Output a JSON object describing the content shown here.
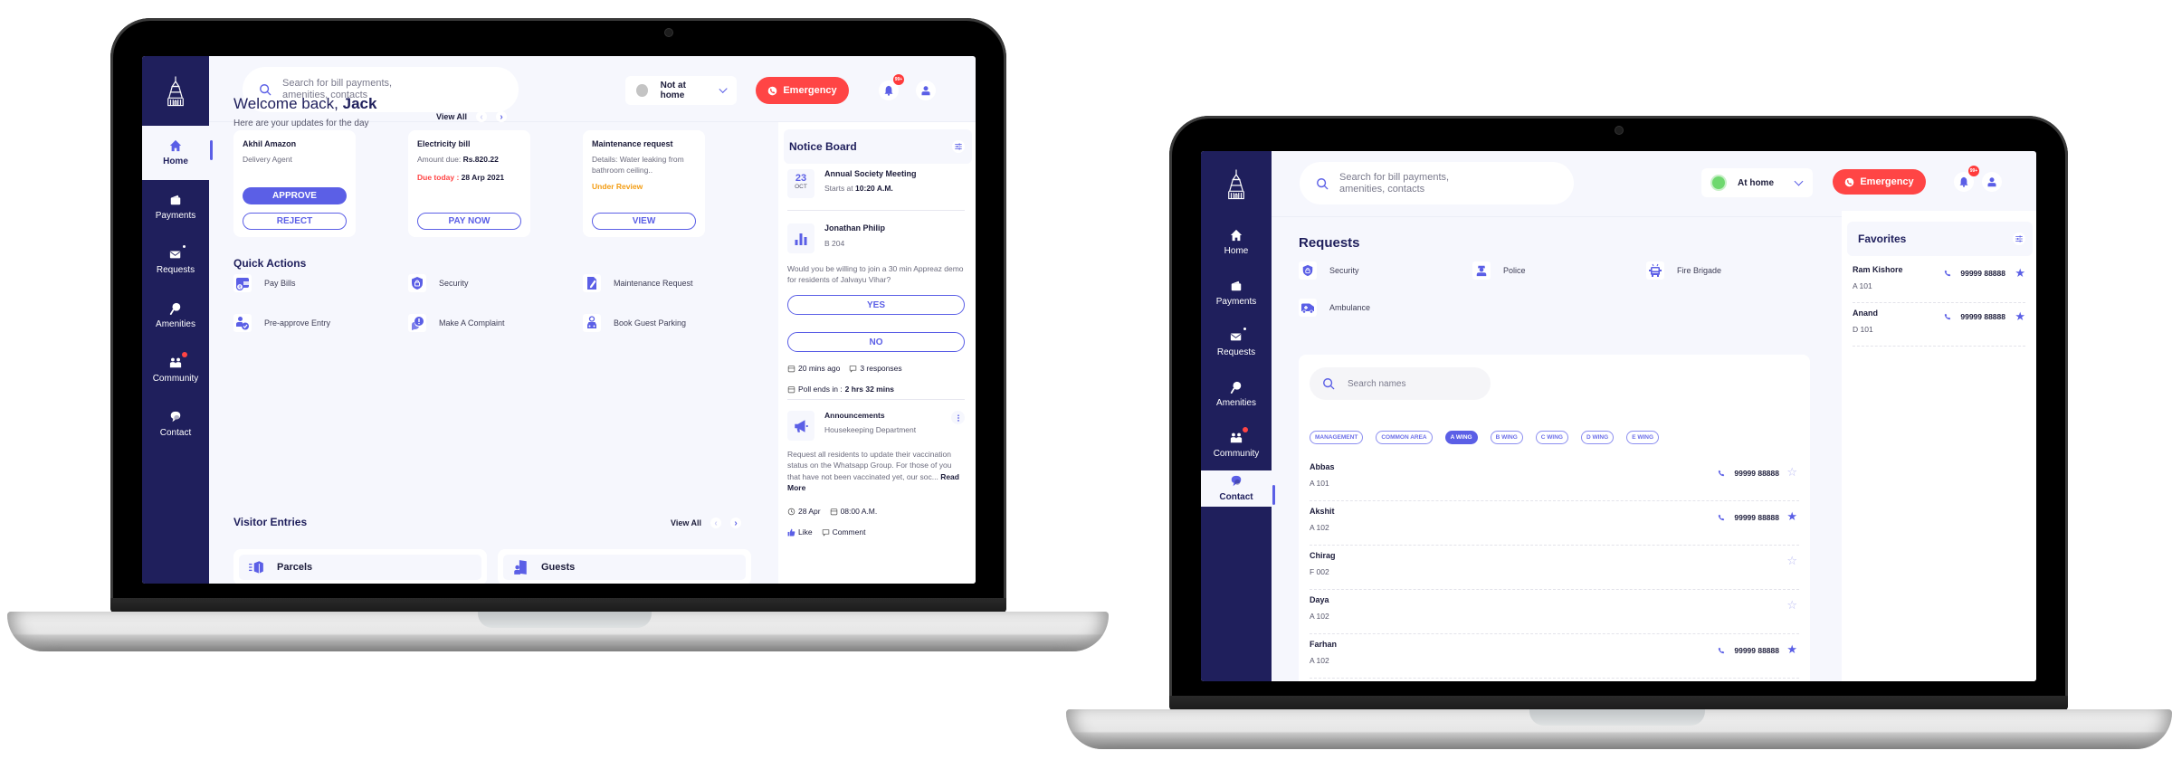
{
  "brand": {
    "primary": "#5b5fe6",
    "sidebar": "#1f1f5c",
    "danger": "#ff4545",
    "warning": "#f39c12",
    "background": "#f6f7fd"
  },
  "sidebar": {
    "logo_icon": "building-icon",
    "items": [
      {
        "label": "Home",
        "icon": "home-icon"
      },
      {
        "label": "Payments",
        "icon": "wallet-icon"
      },
      {
        "label": "Requests",
        "icon": "mail-icon"
      },
      {
        "label": "Amenities",
        "icon": "table-tennis-icon"
      },
      {
        "label": "Community",
        "icon": "people-icon"
      },
      {
        "label": "Contact",
        "icon": "chat-icon"
      }
    ]
  },
  "topbar": {
    "search_placeholder": "Search for bill payments, amenities, contacts",
    "emergency_label": "Emergency",
    "notification_badge": "99+"
  },
  "home_screen": {
    "status": {
      "label": "Not at home",
      "color": "#c4c4c4"
    },
    "welcome_prefix": "Welcome back,",
    "user_name": "Jack",
    "subtitle": "Here are your updates for the day",
    "view_all": "View All",
    "cards": [
      {
        "title": "Akhil Amazon",
        "line1": "Delivery Agent",
        "primary_button": "APPROVE",
        "secondary_button": "REJECT"
      },
      {
        "title": "Electricity bill",
        "amount_label": "Amount due:",
        "amount_value": "Rs.820.22",
        "due_label": "Due today",
        "due_date": "28 Arp 2021",
        "secondary_button": "PAY NOW"
      },
      {
        "title": "Maintenance request",
        "details": "Details: Water leaking from bathroom ceiling..",
        "status": "Under Review",
        "secondary_button": "VIEW"
      }
    ],
    "quick_actions_title": "Quick Actions",
    "quick_actions": [
      {
        "label": "Pay Bills",
        "icon": "wallet-rupee-icon"
      },
      {
        "label": "Security",
        "icon": "shield-lock-icon"
      },
      {
        "label": "Maintenance Request",
        "icon": "edit-document-icon"
      },
      {
        "label": "Pre-approve Entry",
        "icon": "user-check-icon"
      },
      {
        "label": "Make A Complaint",
        "icon": "complaint-icon"
      },
      {
        "label": "Book Guest Parking",
        "icon": "car-pin-icon"
      }
    ],
    "visitor_entries_title": "Visitor Entries",
    "visitor_entries": [
      {
        "label": "Parcels",
        "icon": "parcel-icon"
      },
      {
        "label": "Guests",
        "icon": "guest-door-icon"
      }
    ],
    "notice_board": {
      "title": "Notice Board",
      "meeting": {
        "day": "23",
        "month": "OCT",
        "title": "Annual Society Meeting",
        "starts_label": "Starts at",
        "time": "10:20 A.M."
      },
      "poll": {
        "author": "Jonathan Philip",
        "unit": "B 204",
        "question": "Would you be willing to join a 30 min Appreaz demo for residents of Jalvayu Vihar?",
        "options": [
          "YES",
          "NO"
        ],
        "posted": "20 mins ago",
        "responses": "3 responses",
        "ends_label": "Poll ends in :",
        "ends_value": "2 hrs 32 mins"
      },
      "announcement": {
        "title": "Announcements",
        "department": "Housekeeping Department",
        "body": "Request all residents to update their vaccination status on the Whatsapp Group. For those of you that have not been vaccinated yet, our soc...",
        "read_more": "Read More",
        "date": "28 Apr",
        "time": "08:00 A.M.",
        "like": "Like",
        "comment": "Comment"
      }
    }
  },
  "contact_screen": {
    "status": {
      "label": "At home",
      "color": "#6fd86f"
    },
    "requests_title": "Requests",
    "requests": [
      {
        "label": "Security",
        "icon": "shield-lock-icon"
      },
      {
        "label": "Police",
        "icon": "police-icon"
      },
      {
        "label": "Fire Brigade",
        "icon": "fire-truck-icon"
      },
      {
        "label": "Ambulance",
        "icon": "ambulance-icon"
      }
    ],
    "name_search_placeholder": "Search names",
    "filters": [
      {
        "label": "MANAGEMENT",
        "active": false
      },
      {
        "label": "COMMON AREA",
        "active": false
      },
      {
        "label": "A WING",
        "active": true
      },
      {
        "label": "B WING",
        "active": false
      },
      {
        "label": "C WING",
        "active": false
      },
      {
        "label": "D WING",
        "active": false
      },
      {
        "label": "E WING",
        "active": false
      }
    ],
    "contacts": [
      {
        "name": "Abbas",
        "unit": "A 101",
        "phone": "99999 88888",
        "favorite": false
      },
      {
        "name": "Akshit",
        "unit": "A 102",
        "phone": "99999 88888",
        "favorite": true
      },
      {
        "name": "Chirag",
        "unit": "F 002",
        "phone": "",
        "favorite": false
      },
      {
        "name": "Daya",
        "unit": "A 102",
        "phone": "",
        "favorite": false
      },
      {
        "name": "Farhan",
        "unit": "A 102",
        "phone": "99999 88888",
        "favorite": true
      }
    ],
    "favorites_title": "Favorites",
    "favorites": [
      {
        "name": "Ram Kishore",
        "unit": "A 101",
        "phone": "99999 88888"
      },
      {
        "name": "Anand",
        "unit": "D 101",
        "phone": "99999 88888"
      }
    ]
  }
}
